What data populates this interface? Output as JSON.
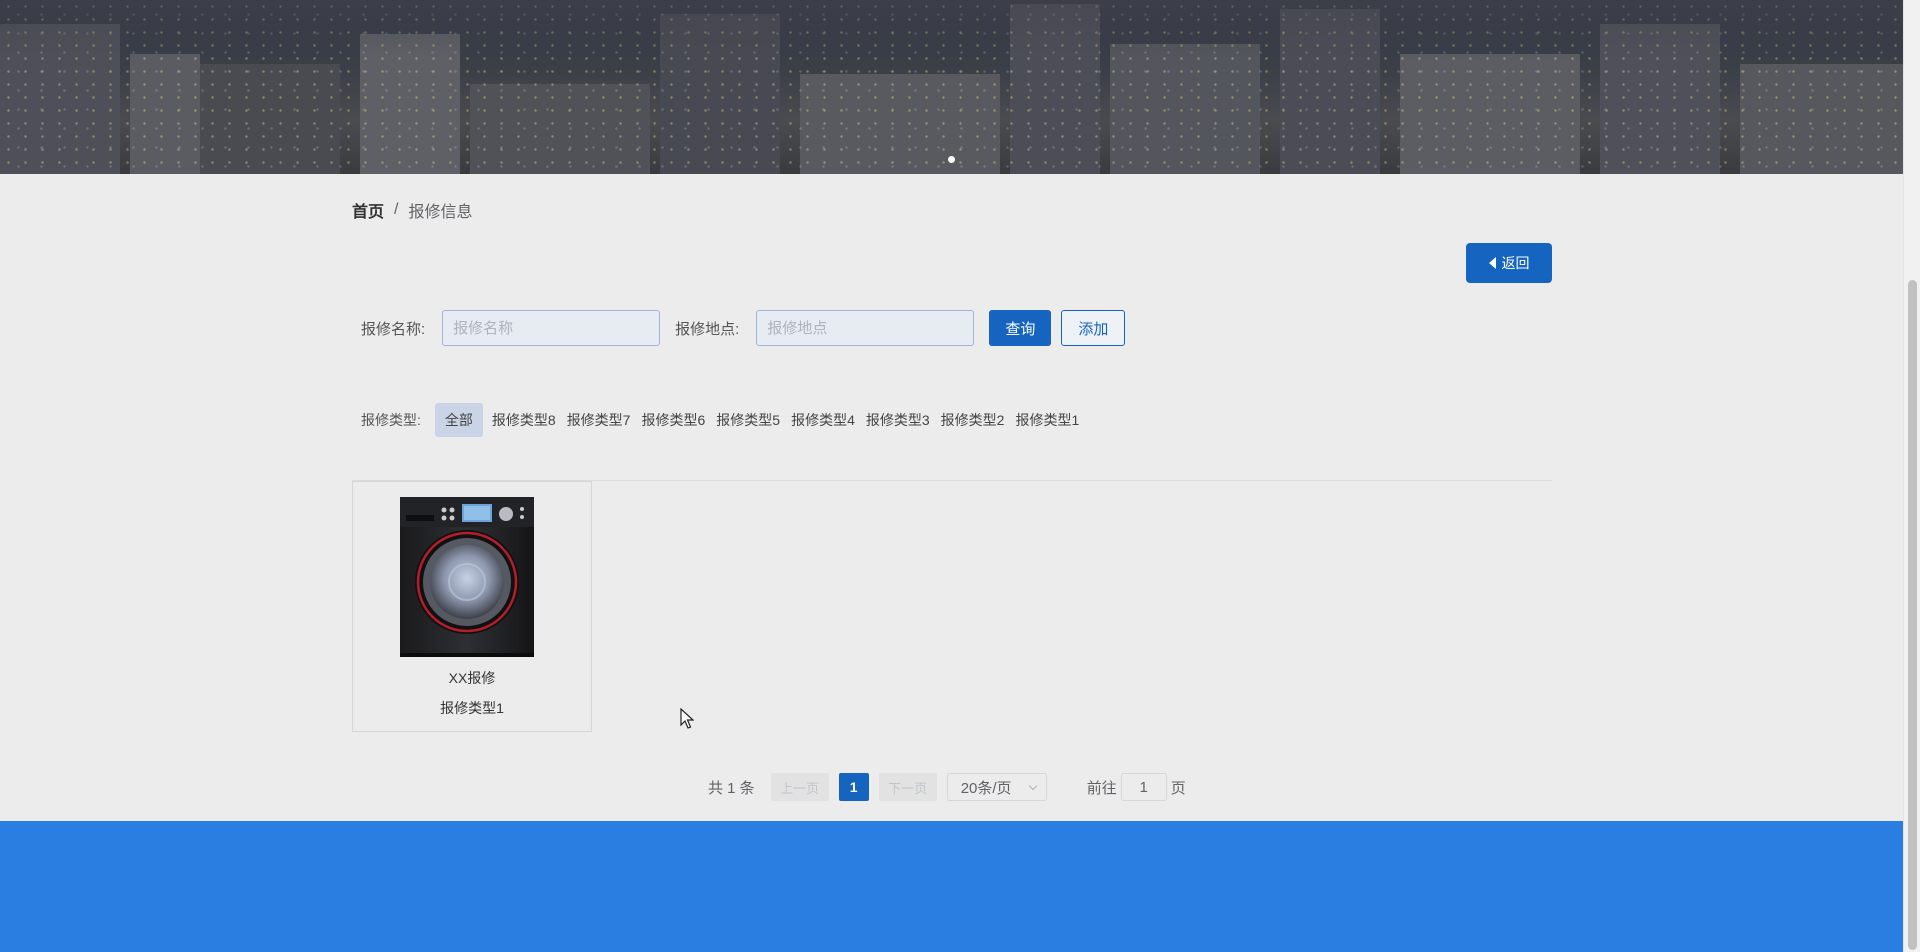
{
  "banner": {
    "active_slide": 1
  },
  "breadcrumb": {
    "home": "首页",
    "separator": "/",
    "current": "报修信息"
  },
  "back_button": {
    "label": "返回"
  },
  "search": {
    "name_label": "报修名称:",
    "name_placeholder": "报修名称",
    "name_value": "",
    "location_label": "报修地点:",
    "location_placeholder": "报修地点",
    "location_value": "",
    "query_label": "查询",
    "add_label": "添加"
  },
  "types": {
    "label": "报修类型:",
    "items": [
      "全部",
      "报修类型8",
      "报修类型7",
      "报修类型6",
      "报修类型5",
      "报修类型4",
      "报修类型3",
      "报修类型2",
      "报修类型1"
    ],
    "active": "全部"
  },
  "items": [
    {
      "name": "XX报修",
      "type": "报修类型1",
      "image": "washing-machine"
    }
  ],
  "pagination": {
    "total": "共 1 条",
    "prev": "上一页",
    "current_page": "1",
    "next": "下一页",
    "page_size": "20条/页",
    "goto_prefix": "前往",
    "goto_value": "1",
    "goto_suffix": "页"
  },
  "colors": {
    "primary": "#1565c0",
    "footer": "#2a7de1",
    "background": "#ececec"
  }
}
